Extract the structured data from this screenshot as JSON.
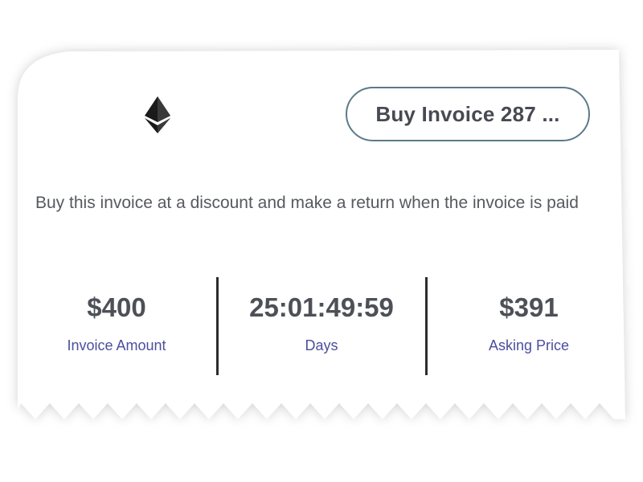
{
  "card": {
    "button_label": "Buy Invoice 287 ...",
    "description": "Buy this invoice at a discount and make a return when the invoice is paid",
    "logo_icon": "ethereum-icon",
    "stats": [
      {
        "value": "$400",
        "label": "Invoice Amount"
      },
      {
        "value": "25:01:49:59",
        "label": "Days"
      },
      {
        "value": "$391",
        "label": "Asking Price"
      }
    ]
  },
  "colors": {
    "button_border": "#5b7a8c",
    "label_accent": "#4b4f9e",
    "value_text": "#4d5057"
  }
}
